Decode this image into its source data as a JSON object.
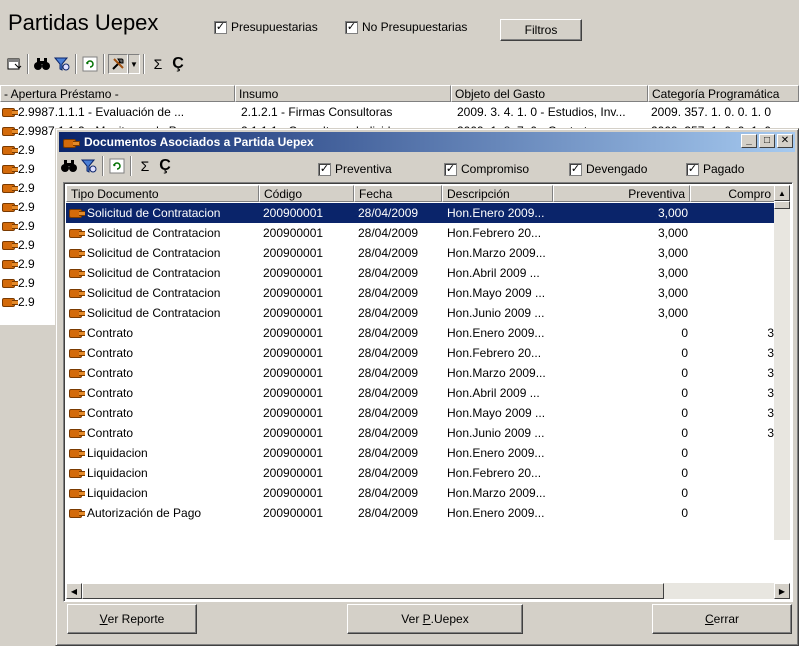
{
  "app": {
    "title": "Partidas Uepex",
    "chk_presupuestarias": "Presupuestarias",
    "chk_no_presupuestarias": "No Presupuestarias",
    "filtros_button": "Filtros",
    "columns": [
      "- Apertura Préstamo -",
      "Insumo",
      "Objeto del Gasto",
      "Categoría Programática"
    ],
    "rows": [
      {
        "apertura": "2.9987.1.1.1  -  Evaluación de ...",
        "insumo": "2.1.2.1  -  Firmas Consultoras",
        "objeto": "2009. 3. 4. 1. 0  -  Estudios, Inv...",
        "categoria": "2009. 357. 1. 0. 0. 1. 0"
      },
      {
        "apertura": "2.9987.1.1.2  -  Monitoreo de P...",
        "insumo": "2.1.1.1  -  Consultores Individua...",
        "objeto": "2009. 1. 8. 7. 0  -  Contratos es...",
        "categoria": "2009. 357. 1. 0. 0. 1. 0"
      },
      {
        "apertura": "2.9",
        "insumo": "",
        "objeto": "",
        "categoria": ""
      },
      {
        "apertura": "2.9",
        "insumo": "",
        "objeto": "",
        "categoria": ""
      },
      {
        "apertura": "2.9",
        "insumo": "",
        "objeto": "",
        "categoria": ""
      },
      {
        "apertura": "2.9",
        "insumo": "",
        "objeto": "",
        "categoria": ""
      },
      {
        "apertura": "2.9",
        "insumo": "",
        "objeto": "",
        "categoria": ""
      },
      {
        "apertura": "2.9",
        "insumo": "",
        "objeto": "",
        "categoria": ""
      },
      {
        "apertura": "2.9",
        "insumo": "",
        "objeto": "",
        "categoria": ""
      },
      {
        "apertura": "2.9",
        "insumo": "",
        "objeto": "",
        "categoria": ""
      },
      {
        "apertura": "2.9",
        "insumo": "",
        "objeto": "",
        "categoria": ""
      }
    ]
  },
  "dialog": {
    "title": "Documentos Asociados a Partida Uepex",
    "chk_preventiva": "Preventiva",
    "chk_compromiso": "Compromiso",
    "chk_devengado": "Devengado",
    "chk_pagado": "Pagado",
    "columns": [
      "Tipo Documento",
      "Código",
      "Fecha",
      "Descripción",
      "Preventiva",
      "Compro"
    ],
    "rows": [
      {
        "tipo": "Solicitud de Contratacion",
        "codigo": "200900001",
        "fecha": "28/04/2009",
        "descripcion": "Hon.Enero 2009...",
        "preventiva": "3,000",
        "compromiso": ""
      },
      {
        "tipo": "Solicitud de Contratacion",
        "codigo": "200900001",
        "fecha": "28/04/2009",
        "descripcion": "Hon.Febrero 20...",
        "preventiva": "3,000",
        "compromiso": ""
      },
      {
        "tipo": "Solicitud de Contratacion",
        "codigo": "200900001",
        "fecha": "28/04/2009",
        "descripcion": "Hon.Marzo 2009...",
        "preventiva": "3,000",
        "compromiso": ""
      },
      {
        "tipo": "Solicitud de Contratacion",
        "codigo": "200900001",
        "fecha": "28/04/2009",
        "descripcion": "Hon.Abril 2009 ...",
        "preventiva": "3,000",
        "compromiso": ""
      },
      {
        "tipo": "Solicitud de Contratacion",
        "codigo": "200900001",
        "fecha": "28/04/2009",
        "descripcion": "Hon.Mayo 2009 ...",
        "preventiva": "3,000",
        "compromiso": ""
      },
      {
        "tipo": "Solicitud de Contratacion",
        "codigo": "200900001",
        "fecha": "28/04/2009",
        "descripcion": "Hon.Junio 2009 ...",
        "preventiva": "3,000",
        "compromiso": ""
      },
      {
        "tipo": "Contrato",
        "codigo": "200900001",
        "fecha": "28/04/2009",
        "descripcion": "Hon.Enero 2009...",
        "preventiva": "0",
        "compromiso": "3"
      },
      {
        "tipo": "Contrato",
        "codigo": "200900001",
        "fecha": "28/04/2009",
        "descripcion": "Hon.Febrero 20...",
        "preventiva": "0",
        "compromiso": "3"
      },
      {
        "tipo": "Contrato",
        "codigo": "200900001",
        "fecha": "28/04/2009",
        "descripcion": "Hon.Marzo 2009...",
        "preventiva": "0",
        "compromiso": "3"
      },
      {
        "tipo": "Contrato",
        "codigo": "200900001",
        "fecha": "28/04/2009",
        "descripcion": "Hon.Abril 2009 ...",
        "preventiva": "0",
        "compromiso": "3"
      },
      {
        "tipo": "Contrato",
        "codigo": "200900001",
        "fecha": "28/04/2009",
        "descripcion": "Hon.Mayo 2009 ...",
        "preventiva": "0",
        "compromiso": "3"
      },
      {
        "tipo": "Contrato",
        "codigo": "200900001",
        "fecha": "28/04/2009",
        "descripcion": "Hon.Junio 2009 ...",
        "preventiva": "0",
        "compromiso": "3"
      },
      {
        "tipo": "Liquidacion",
        "codigo": "200900001",
        "fecha": "28/04/2009",
        "descripcion": "Hon.Enero 2009...",
        "preventiva": "0",
        "compromiso": ""
      },
      {
        "tipo": "Liquidacion",
        "codigo": "200900001",
        "fecha": "28/04/2009",
        "descripcion": "Hon.Febrero 20...",
        "preventiva": "0",
        "compromiso": ""
      },
      {
        "tipo": "Liquidacion",
        "codigo": "200900001",
        "fecha": "28/04/2009",
        "descripcion": "Hon.Marzo 2009...",
        "preventiva": "0",
        "compromiso": ""
      },
      {
        "tipo": "Autorización de Pago",
        "codigo": "200900001",
        "fecha": "28/04/2009",
        "descripcion": "Hon.Enero 2009...",
        "preventiva": "0",
        "compromiso": ""
      }
    ],
    "btn_ver_reporte_u": "V",
    "btn_ver_reporte_rest": "er Reporte",
    "btn_ver_uepex_pre": "Ver ",
    "btn_ver_uepex_u": "P",
    "btn_ver_uepex_rest": ".Uepex",
    "btn_cerrar_u": "C",
    "btn_cerrar_rest": "errar"
  },
  "colors": {
    "selection": "#0a246a",
    "title_start": "#0a246a",
    "title_end": "#a6caf0",
    "hand_icon": "#d36a0a"
  },
  "icons": [
    "properties-icon",
    "binoculars-icon",
    "filter-icon",
    "refresh-icon",
    "tools-icon",
    "sigma-icon",
    "cedilla-icon",
    "hand-pointer-icon"
  ]
}
